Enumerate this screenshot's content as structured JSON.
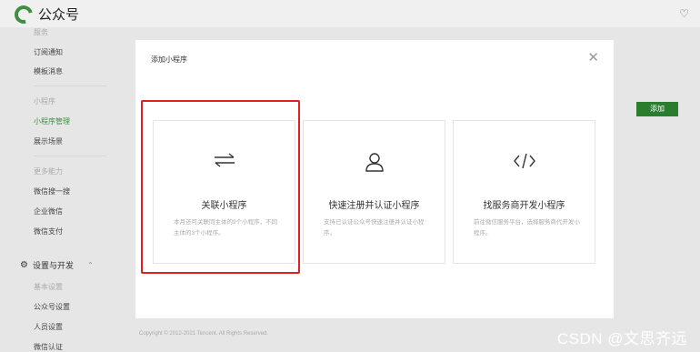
{
  "app": {
    "title": "公众号"
  },
  "sidebar": {
    "items": [
      {
        "label": "服务",
        "type": "group"
      },
      {
        "label": "订阅通知",
        "type": "item"
      },
      {
        "label": "模板消息",
        "type": "item"
      },
      {
        "label": "小程序",
        "type": "group"
      },
      {
        "label": "小程序管理",
        "type": "active"
      },
      {
        "label": "展示场景",
        "type": "item"
      },
      {
        "label": "更多能力",
        "type": "group"
      },
      {
        "label": "微信搜一搜",
        "type": "item"
      },
      {
        "label": "企业微信",
        "type": "item"
      },
      {
        "label": "微信支付",
        "type": "item"
      },
      {
        "label": "设置与开发",
        "type": "section"
      },
      {
        "label": "基本设置",
        "type": "group"
      },
      {
        "label": "公众号设置",
        "type": "item"
      },
      {
        "label": "人员设置",
        "type": "item"
      },
      {
        "label": "微信认证",
        "type": "item"
      }
    ]
  },
  "page": {
    "add_button": "添加",
    "copyright": "Copyright © 2012-2021 Tencent. All Rights Reserved."
  },
  "modal": {
    "title": "添加小程序",
    "close_icon": "close-icon",
    "cards": [
      {
        "label": "关联小程序",
        "desc": "本月还可关联同主体的9个小程序，不同主体的3个小程序。",
        "icon": "arrows-swap-icon"
      },
      {
        "label": "快速注册并认证小程序",
        "desc": "支持已认证公众号快速注册并认证小程序。",
        "icon": "user-icon"
      },
      {
        "label": "找服务商开发小程序",
        "desc": "前往微信服务平台，选择服务商代开发小程序。",
        "icon": "code-icon"
      }
    ]
  },
  "watermark": "CSDN @文思齐远",
  "colors": {
    "brand": "#3e8e41",
    "highlight": "#e02020",
    "add_button": "#2a7d2d"
  }
}
